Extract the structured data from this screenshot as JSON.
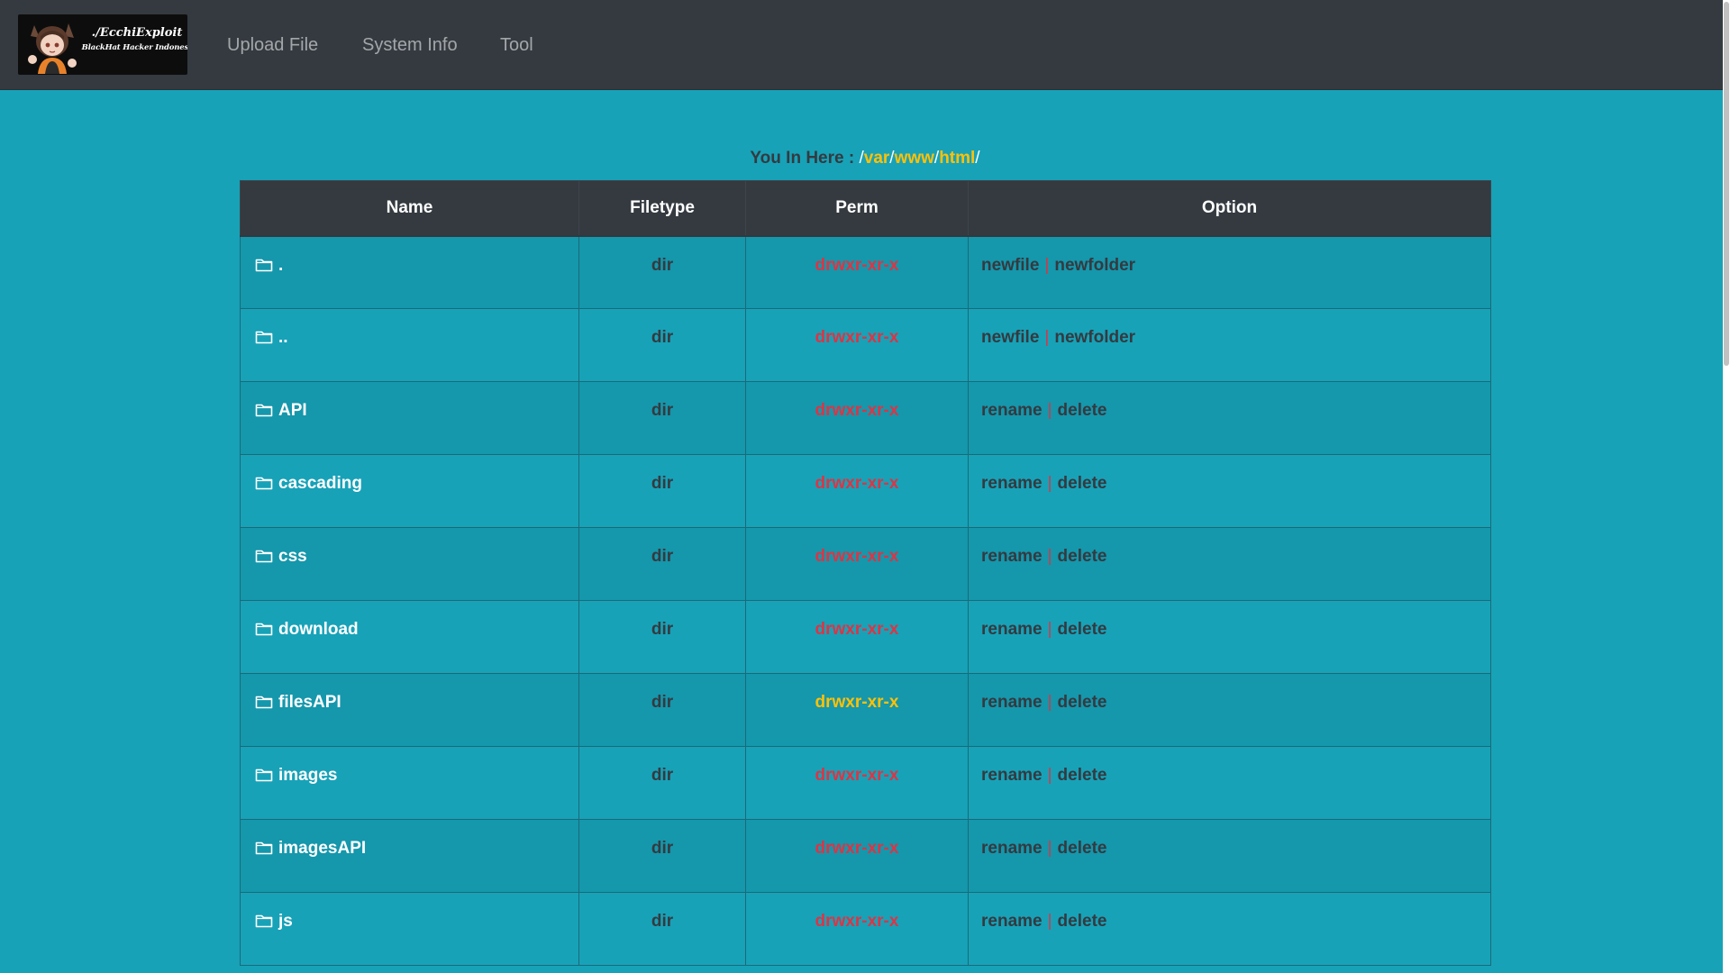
{
  "brand": {
    "title": "./EcchiExploit",
    "subtitle": "BlackHat Hacker Indonesia"
  },
  "nav": {
    "items": [
      {
        "label": "Upload File"
      },
      {
        "label": "System Info"
      },
      {
        "label": "Tool"
      }
    ]
  },
  "location": {
    "prefix": "You In Here : ",
    "separator": "/",
    "segments": [
      "var",
      "www",
      "html"
    ]
  },
  "table": {
    "headers": {
      "name": "Name",
      "filetype": "Filetype",
      "perm": "Perm",
      "option": "Option"
    },
    "rows": [
      {
        "name": ".",
        "type": "dir",
        "perm": "drwxr-xr-x",
        "perm_color": "#dc3545",
        "opt1": "newfile",
        "opt2": "newfolder"
      },
      {
        "name": "..",
        "type": "dir",
        "perm": "drwxr-xr-x",
        "perm_color": "#dc3545",
        "opt1": "newfile",
        "opt2": "newfolder"
      },
      {
        "name": "API",
        "type": "dir",
        "perm": "drwxr-xr-x",
        "perm_color": "#dc3545",
        "opt1": "rename",
        "opt2": "delete"
      },
      {
        "name": "cascading",
        "type": "dir",
        "perm": "drwxr-xr-x",
        "perm_color": "#dc3545",
        "opt1": "rename",
        "opt2": "delete"
      },
      {
        "name": "css",
        "type": "dir",
        "perm": "drwxr-xr-x",
        "perm_color": "#dc3545",
        "opt1": "rename",
        "opt2": "delete"
      },
      {
        "name": "download",
        "type": "dir",
        "perm": "drwxr-xr-x",
        "perm_color": "#dc3545",
        "opt1": "rename",
        "opt2": "delete"
      },
      {
        "name": "filesAPI",
        "type": "dir",
        "perm": "drwxr-xr-x",
        "perm_color": "#ffc107",
        "opt1": "rename",
        "opt2": "delete"
      },
      {
        "name": "images",
        "type": "dir",
        "perm": "drwxr-xr-x",
        "perm_color": "#dc3545",
        "opt1": "rename",
        "opt2": "delete"
      },
      {
        "name": "imagesAPI",
        "type": "dir",
        "perm": "drwxr-xr-x",
        "perm_color": "#dc3545",
        "opt1": "rename",
        "opt2": "delete"
      },
      {
        "name": "js",
        "type": "dir",
        "perm": "drwxr-xr-x",
        "perm_color": "#dc3545",
        "opt1": "rename",
        "opt2": "delete"
      }
    ],
    "option_separator": "|"
  },
  "colors": {
    "page_bg": "#17a2b8",
    "navbar_bg": "#343a40",
    "accent_yellow": "#ffc107",
    "accent_red": "#dc3545",
    "dark_text": "#343a40"
  }
}
